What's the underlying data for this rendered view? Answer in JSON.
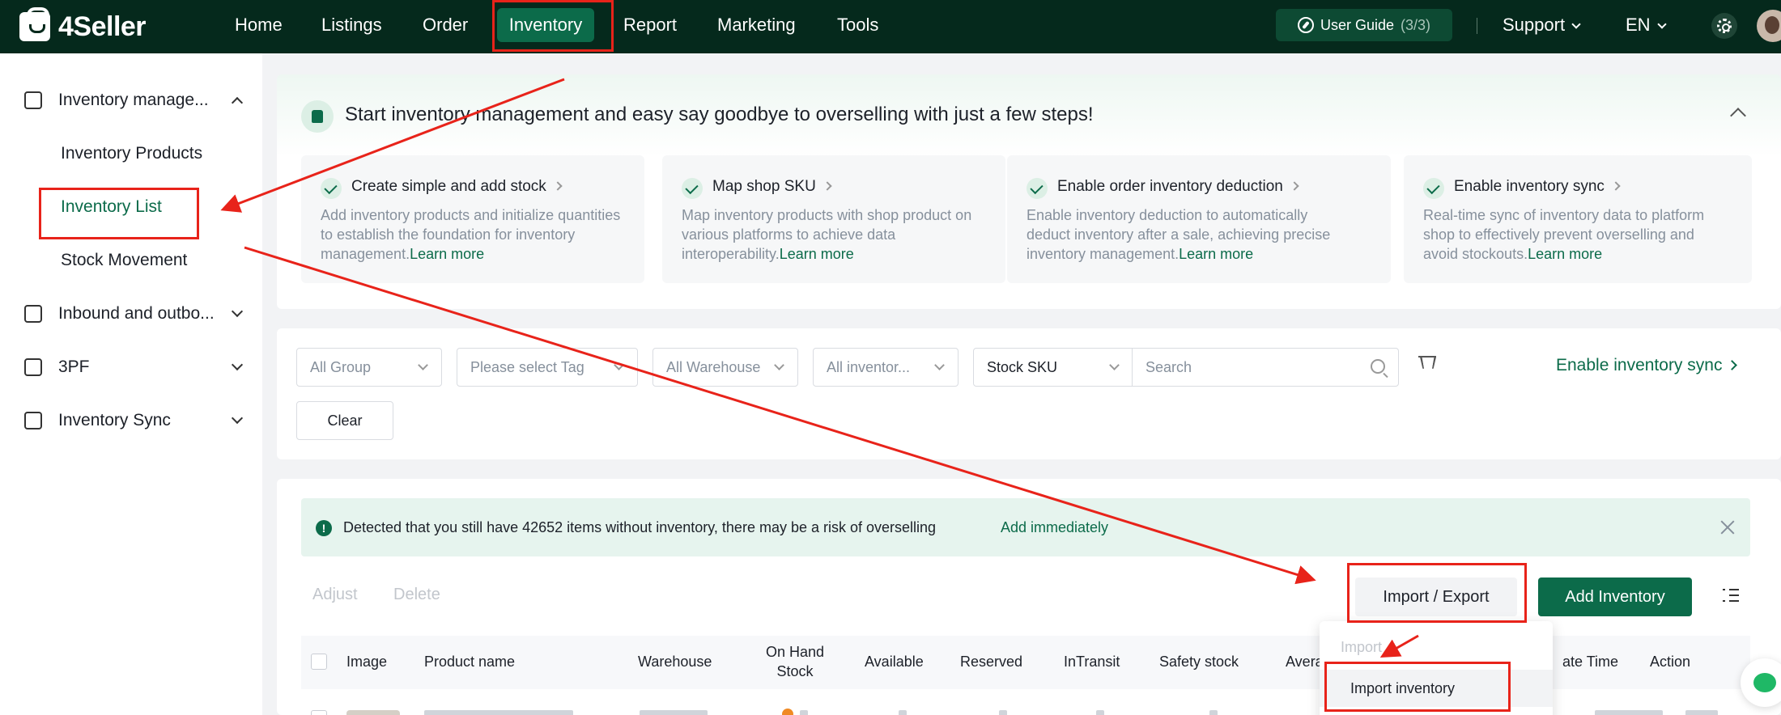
{
  "app": {
    "logo": "4Seller"
  },
  "topnav": {
    "items": [
      "Home",
      "Listings",
      "Order",
      "Inventory",
      "Report",
      "Marketing",
      "Tools"
    ],
    "active": "Inventory",
    "user_guide_label": "User Guide",
    "user_guide_count": "(3/3)",
    "support_label": "Support",
    "language": "EN"
  },
  "sidebar": {
    "inventory_management": "Inventory manage...",
    "sub_items": [
      "Inventory Products",
      "Inventory List",
      "Stock Movement"
    ],
    "active_sub": "Inventory List",
    "inbound": "Inbound and outbo...",
    "threepf": "3PF",
    "inventory_sync": "Inventory Sync"
  },
  "guide": {
    "title": "Start inventory management and easy say goodbye to overselling with just a few steps!",
    "learn_more": "Learn more",
    "steps": [
      {
        "title": "Create simple and add stock",
        "desc": "Add inventory products and initialize quantities to establish the foundation for inventory management."
      },
      {
        "title": "Map shop SKU",
        "desc": "Map inventory products with shop product on various platforms to achieve data interoperability."
      },
      {
        "title": "Enable order inventory deduction",
        "desc": "Enable inventory deduction to automatically deduct inventory after a sale, achieving precise inventory management."
      },
      {
        "title": "Enable inventory sync",
        "desc": "Real-time sync of inventory data to platform shop to effectively prevent overselling and avoid stockouts."
      }
    ]
  },
  "filters": {
    "group": "All Group",
    "tag_placeholder": "Please select Tag",
    "warehouse": "All Warehouse",
    "inventory": "All inventor...",
    "sku_type": "Stock SKU",
    "search_placeholder": "Search",
    "enable_sync": "Enable inventory sync",
    "clear": "Clear"
  },
  "alert": {
    "text": "Detected that you still have 42652 items without inventory, there may be a risk of overselling",
    "link": "Add immediately"
  },
  "toolbar": {
    "adjust": "Adjust",
    "delete": "Delete",
    "import_export": "Import / Export",
    "add_inventory": "Add Inventory"
  },
  "dropdown": {
    "header": "Import",
    "item": "Import inventory"
  },
  "table": {
    "headers": {
      "image": "Image",
      "product_name": "Product name",
      "warehouse": "Warehouse",
      "on_hand_1": "On Hand",
      "on_hand_2": "Stock",
      "available": "Available",
      "reserved": "Reserved",
      "intransit": "InTransit",
      "safety_stock": "Safety stock",
      "avera": "Avera",
      "create_time": "ate Time",
      "action": "Action"
    }
  },
  "colors": {
    "brand_dark": "#05291c",
    "brand_green": "#0c6b4a",
    "annotation_red": "#e8231a"
  }
}
